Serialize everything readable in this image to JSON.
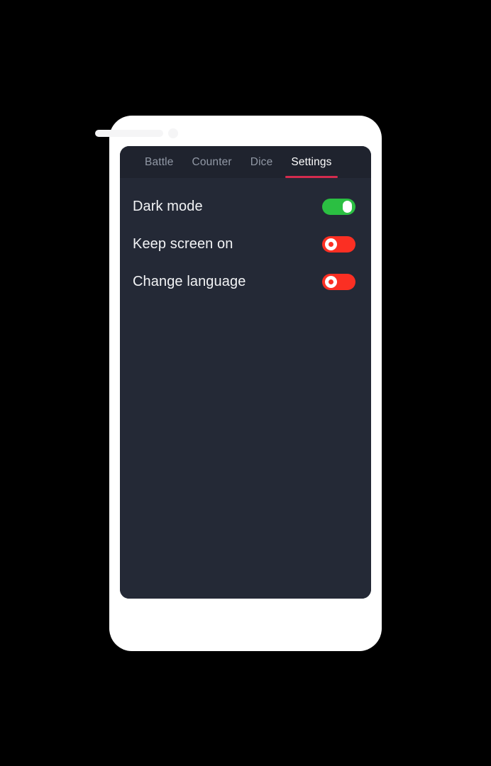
{
  "device": {
    "frame_color": "#ffffff",
    "speaker_icon": "speaker-grille",
    "camera_icon": "front-camera-dot",
    "hardware_color": "#f5f5f6"
  },
  "screen": {
    "background": "#242936",
    "tabbar_background": "#1f232e",
    "accent": "#d42b4e"
  },
  "tabs": [
    {
      "label": "Battle",
      "active": false,
      "name": "tab-battle"
    },
    {
      "label": "Counter",
      "active": false,
      "name": "tab-counter"
    },
    {
      "label": "Dice",
      "active": false,
      "name": "tab-dice"
    },
    {
      "label": "Settings",
      "active": true,
      "name": "tab-settings"
    }
  ],
  "settings": {
    "rows": [
      {
        "label": "Dark mode",
        "state": "on",
        "track_color": "#2bbf42",
        "knob_icon": "toggle-knob-pill"
      },
      {
        "label": "Keep screen on",
        "state": "off",
        "track_color": "#fb2f23",
        "knob_icon": "toggle-knob-ring"
      },
      {
        "label": "Change language",
        "state": "off",
        "track_color": "#fb2f23",
        "knob_icon": "toggle-knob-ring"
      }
    ]
  }
}
